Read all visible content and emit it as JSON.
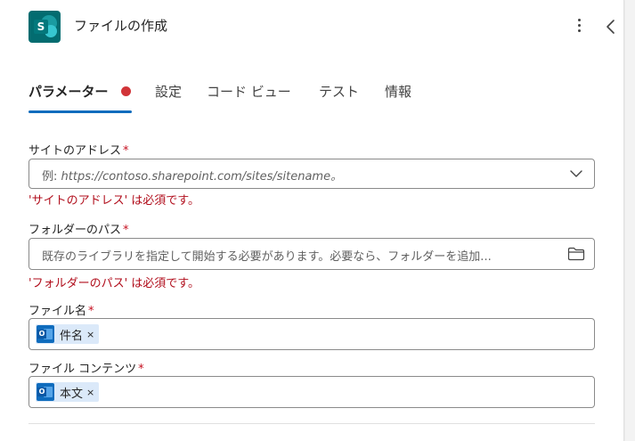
{
  "header": {
    "title": "ファイルの作成",
    "app_icon_letter": "S",
    "app_icon": "sharepoint-icon",
    "more_icon": "more-vertical-icon",
    "collapse_icon": "chevron-left-icon"
  },
  "tabs": [
    {
      "label": "パラメーター",
      "active": true,
      "has_error": true
    },
    {
      "label": "設定"
    },
    {
      "label": "コード ビュー"
    },
    {
      "label": "テスト"
    },
    {
      "label": "情報"
    }
  ],
  "required_mark": "*",
  "fields": {
    "site_address": {
      "label": "サイトのアドレス",
      "placeholder_prefix": "例: ",
      "placeholder_url": "https://contoso.sharepoint.com/sites/sitename。",
      "error": "'サイトのアドレス' は必須です。",
      "icon": "chevron-down-icon"
    },
    "folder_path": {
      "label": "フォルダーのパス",
      "placeholder": "既存のライブラリを指定して開始する必要があります。必要なら、フォルダーを追加...",
      "error": "'フォルダーのパス' は必須です。",
      "icon": "folder-icon"
    },
    "file_name": {
      "label": "ファイル名",
      "token": {
        "text": "件名",
        "icon": "outlook-icon",
        "remove": "×"
      }
    },
    "file_content": {
      "label": "ファイル コンテンツ",
      "token": {
        "text": "本文",
        "icon": "outlook-icon",
        "remove": "×"
      }
    }
  },
  "colors": {
    "accent": "#0f6cbd",
    "error": "#b10e1c",
    "error_dot": "#d13438",
    "token_bg": "#dbe9f9",
    "sharepoint": "#036c70"
  }
}
